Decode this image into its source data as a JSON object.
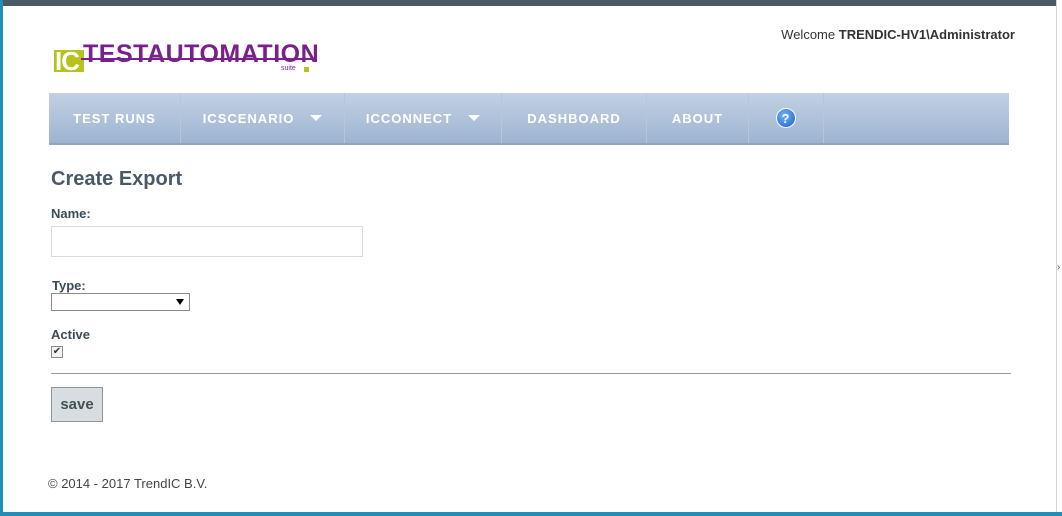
{
  "header": {
    "logo": {
      "ic": "IC",
      "brand": "TESTAUTOMATION",
      "suite": "suite"
    },
    "welcome_prefix": "Welcome",
    "welcome_user": "TRENDIC-HV1\\Administrator"
  },
  "nav": {
    "items": [
      {
        "label": "TEST RUNS",
        "dropdown": false
      },
      {
        "label": "ICSCENARIO",
        "dropdown": true
      },
      {
        "label": "ICCONNECT",
        "dropdown": true
      },
      {
        "label": "DASHBOARD",
        "dropdown": false
      },
      {
        "label": "ABOUT",
        "dropdown": false
      }
    ],
    "help_icon": "help-icon"
  },
  "form": {
    "title": "Create Export",
    "name_label": "Name:",
    "name_value": "",
    "type_label": "Type:",
    "type_value": "",
    "active_label": "Active",
    "active_checked": true,
    "save_label": "save"
  },
  "footer": {
    "text": "© 2014 - 2017 TrendIC B.V."
  },
  "colors": {
    "brand": "#7a1f8c",
    "brand_accent": "#b7c21b",
    "nav_bg": "#a9bdd6",
    "window_border": "#1f8fb8"
  }
}
